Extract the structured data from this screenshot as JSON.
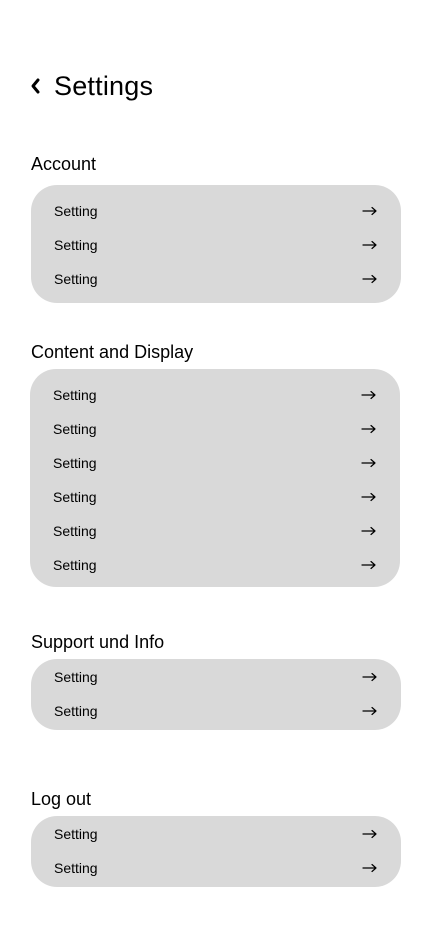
{
  "header": {
    "title": "Settings",
    "back_icon": "chevron-left-icon"
  },
  "sections": [
    {
      "label": "Account",
      "items": [
        "Setting",
        "Setting",
        "Setting"
      ]
    },
    {
      "label": "Content and Display",
      "items": [
        "Setting",
        "Setting",
        "Setting",
        "Setting",
        "Setting",
        "Setting"
      ]
    },
    {
      "label": "Support und Info",
      "items": [
        "Setting",
        "Setting"
      ]
    },
    {
      "label": "Log out",
      "items": [
        "Setting",
        "Setting"
      ]
    }
  ],
  "row_icon": "arrow-right-icon",
  "colors": {
    "card_background": "#d9d9d9",
    "text": "#000000",
    "page_background": "#ffffff"
  }
}
